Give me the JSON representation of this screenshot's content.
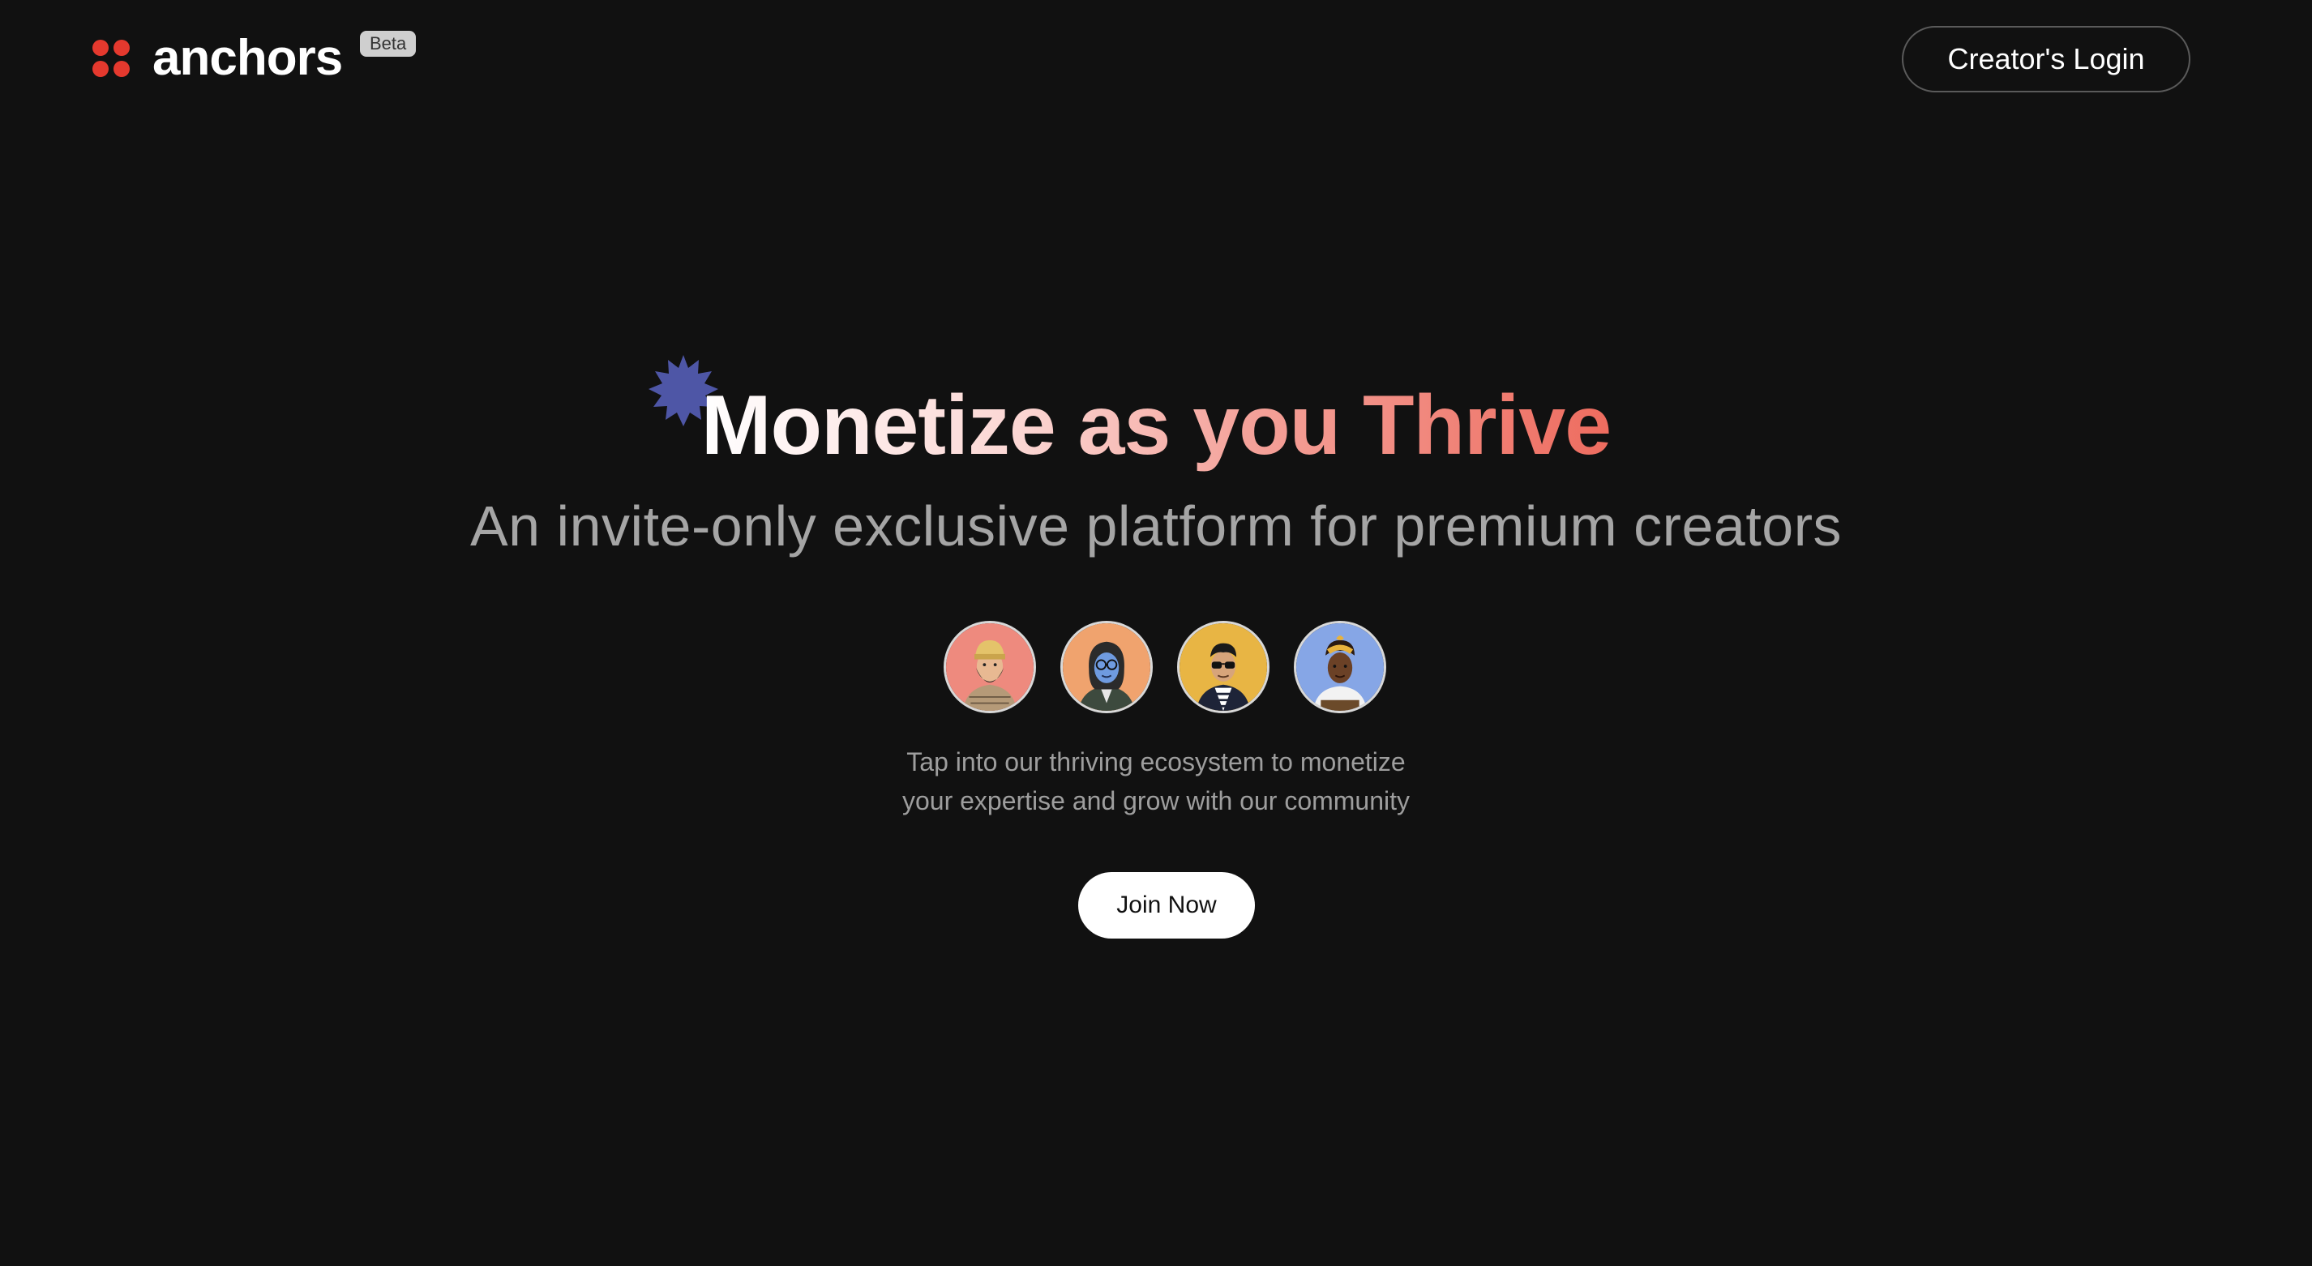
{
  "header": {
    "brand_name": "anchors",
    "badge": "Beta",
    "login_label": "Creator's Login"
  },
  "hero": {
    "title": "Monetize as you Thrive",
    "subtitle": "An invite-only exclusive platform for premium creators",
    "description_line1": "Tap into our thriving ecosystem to monetize",
    "description_line2": "your expertise and grow with our community",
    "cta_label": "Join Now"
  },
  "avatars": [
    {
      "name": "creator-avatar-1",
      "bg": "#ee8a7e"
    },
    {
      "name": "creator-avatar-2",
      "bg": "#f0a36e"
    },
    {
      "name": "creator-avatar-3",
      "bg": "#e8b544"
    },
    {
      "name": "creator-avatar-4",
      "bg": "#86a6e6"
    }
  ],
  "colors": {
    "background": "#111111",
    "brand_red": "#e5392e",
    "star_purple": "#4e56a6",
    "title_gradient_end": "#ee6c5f"
  }
}
